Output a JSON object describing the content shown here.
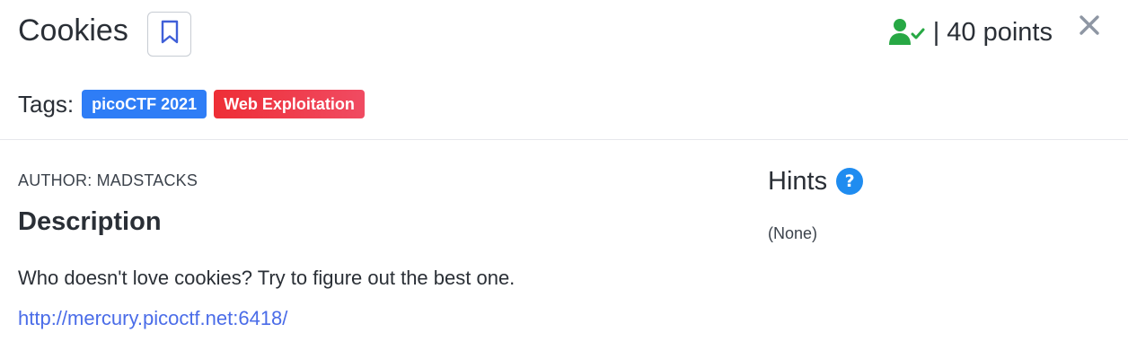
{
  "challenge": {
    "title": "Cookies",
    "points_label": "| 40 points",
    "tags_label": "Tags:",
    "tags": [
      {
        "label": "picoCTF 2021",
        "color": "#2e7df6"
      },
      {
        "label": "Web Exploitation",
        "color": "#ee2e36"
      }
    ],
    "author": "AUTHOR: MADSTACKS",
    "description_heading": "Description",
    "description": "Who doesn't love cookies? Try to figure out the best one.",
    "link": "http://mercury.picoctf.net:6418/",
    "hints_heading": "Hints",
    "hints_help_glyph": "?",
    "hints_value": "(None)"
  },
  "icons": {
    "bookmark": "bookmark-icon",
    "solved": "user-check-icon",
    "close": "close-icon",
    "help": "question-circle-icon"
  },
  "colors": {
    "solved_green": "#27a844",
    "bookmark_blue": "#3f5fd8",
    "link_blue": "#4a6ce8",
    "help_blue": "#1f8cf0",
    "close_gray": "#8e96a3"
  }
}
